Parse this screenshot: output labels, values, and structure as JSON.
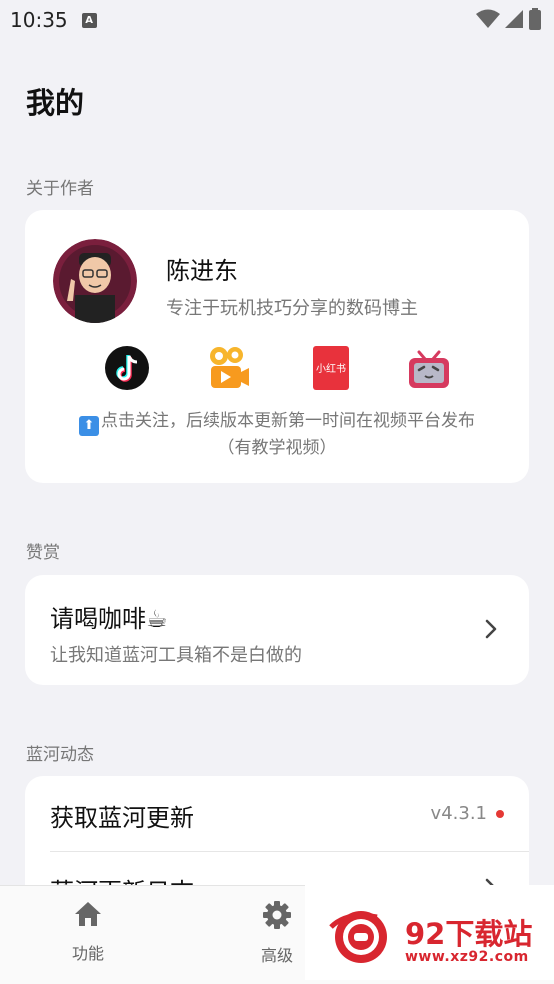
{
  "status": {
    "time": "10:35",
    "badge": "A"
  },
  "page": {
    "title": "我的"
  },
  "about": {
    "section_label": "关于作者",
    "name": "陈进东",
    "description": "专注于玩机技巧分享的数码博主",
    "follow_note_line1": "点击关注，后续版本更新第一时间在视频平台发布",
    "follow_note_line2": "（有教学视频）",
    "social_icons": [
      "douyin-icon",
      "kuaishou-icon",
      "xiaohongshu-icon",
      "bilibili-icon"
    ],
    "xiaohongshu_logo_text": "小红书"
  },
  "reward": {
    "section_label": "赞赏",
    "title": "请喝咖啡☕",
    "subtitle": "让我知道蓝河工具箱不是白做的"
  },
  "news": {
    "section_label": "蓝河动态",
    "update_label": "获取蓝河更新",
    "version": "v4.3.1",
    "log_label": "蓝河更新日志"
  },
  "nav": {
    "items": [
      {
        "label": "功能",
        "icon": "home-icon"
      },
      {
        "label": "高级",
        "icon": "gear-icon"
      }
    ]
  },
  "watermark": {
    "text": "92下载站",
    "url": "www.xz92.com"
  },
  "colors": {
    "background": "#f2f2f6",
    "card": "#ffffff",
    "accent_red": "#e53935",
    "watermark_red": "#d8262f"
  }
}
